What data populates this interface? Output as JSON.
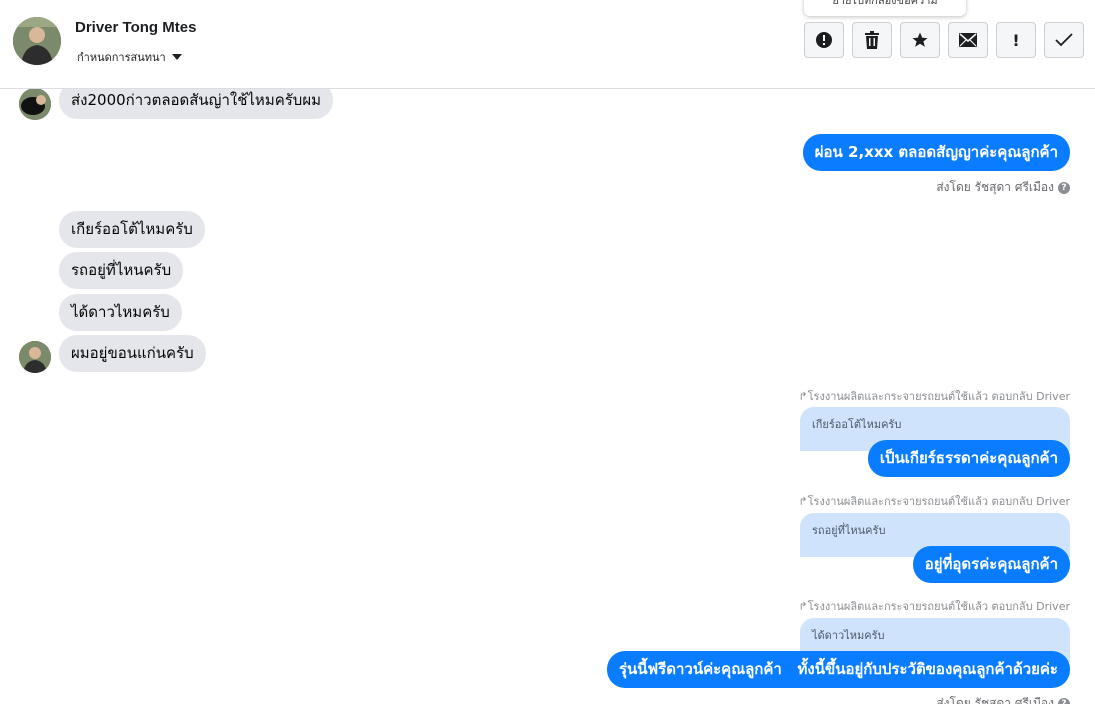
{
  "header": {
    "name": "Driver Tong Mtes",
    "assign_label": "กำหนดการสนทนา",
    "tooltip": "ย้ายไปที่กล่องข้อความ",
    "buttons": {
      "spam": "Mark as spam",
      "delete": "Delete",
      "star": "Star",
      "unread": "Mark as unread",
      "important": "!",
      "done": "Done"
    }
  },
  "messages": {
    "in1": "ส่ง2000ก่าวตลอดสันญ่าใช้ไหมครับผม",
    "out1": "ผ่อน 2,xxx ตลอดสัญญาค่ะคุณลูกค้า",
    "sent_by1": "ส่งโดย รัชสุดา ศรีเมือง",
    "in2": "เกียร์ออโต้ไหมครับ",
    "in3": "รถอยู่ที่ไหนครับ",
    "in4": "ได้ดาวไหมครับ",
    "in5": "ผมอยู่ขอนแก่นครับ",
    "reply1_meta": "โรงงานผลิตและกระจายรถยนต์ใช้แล้ว ตอบกลับ Driver",
    "reply1_quote": "เกียร์ออโต้ไหมครับ",
    "reply1_text": "เป็นเกียร์ธรรดาค่ะคุณลูกค้า",
    "reply2_meta": "โรงงานผลิตและกระจายรถยนต์ใช้แล้ว ตอบกลับ Driver",
    "reply2_quote": "รถอยู่ที่ไหนครับ",
    "reply2_text": "อยู่ที่อุดรค่ะคุณลูกค้า",
    "reply3_meta": "โรงงานผลิตและกระจายรถยนต์ใช้แล้ว ตอบกลับ Driver",
    "reply3_quote": "ได้ดาวไหมครับ",
    "reply3_text": "รุ่นนี้ฟรีดาวน์ค่ะคุณลูกค้า   ทั้งนี้ขึ้นอยู่กับประวัติของคุณลูกค้าด้วยค่ะ",
    "sent_by2": "ส่งโดย รัชสุดา ศรีเมือง"
  },
  "colors": {
    "outgoing": "#0a7cff",
    "incoming": "#e4e6eb",
    "quote": "#cfe3fc"
  }
}
